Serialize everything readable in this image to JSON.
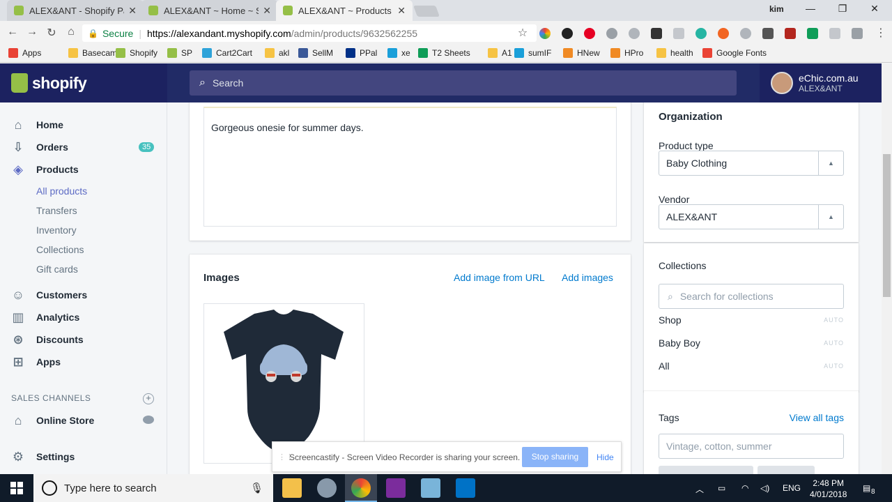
{
  "browser": {
    "tabs": [
      {
        "title": "ALEX&ANT - Shopify Par"
      },
      {
        "title": "ALEX&ANT ~ Home ~ Sh"
      },
      {
        "title": "ALEX&ANT ~ Products ~"
      }
    ],
    "profile_name": "kim",
    "secure_label": "Secure",
    "url_host": "https://alexandant.myshopify.com",
    "url_path": "/admin/products/9632562255"
  },
  "bookmarks": [
    {
      "label": "Apps",
      "color": "#e94235"
    },
    {
      "label": "Basecamp",
      "color": "#f6c344"
    },
    {
      "label": "Shopify",
      "color": "#95bf47"
    },
    {
      "label": "SP",
      "color": "#95bf47"
    },
    {
      "label": "Cart2Cart",
      "color": "#2ea3d9"
    },
    {
      "label": "akl",
      "color": "#f6c344"
    },
    {
      "label": "SellM",
      "color": "#3b5998"
    },
    {
      "label": "PPal",
      "color": "#003087"
    },
    {
      "label": "xe",
      "color": "#1a9fd9"
    },
    {
      "label": "T2 Sheets",
      "color": "#0f9d58"
    },
    {
      "label": "A1",
      "color": "#f6c344"
    },
    {
      "label": "sumIF",
      "color": "#1a9fd9"
    },
    {
      "label": "HNew",
      "color": "#f08a24"
    },
    {
      "label": "HPro",
      "color": "#f08a24"
    },
    {
      "label": "health",
      "color": "#f6c344"
    },
    {
      "label": "Google Fonts",
      "color": "#ea4335"
    }
  ],
  "header": {
    "logo": "shopify",
    "search_placeholder": "Search",
    "store_name": "eChic.com.au",
    "store_owner": "ALEX&ANT"
  },
  "sidebar": {
    "items": [
      {
        "label": "Home",
        "icon": "home-icon"
      },
      {
        "label": "Orders",
        "icon": "orders-icon",
        "badge": "35"
      },
      {
        "label": "Products",
        "icon": "tag-icon"
      }
    ],
    "sub_items": [
      "All products",
      "Transfers",
      "Inventory",
      "Collections",
      "Gift cards"
    ],
    "items2": [
      {
        "label": "Customers",
        "icon": "person-icon"
      },
      {
        "label": "Analytics",
        "icon": "bar-chart-icon"
      },
      {
        "label": "Discounts",
        "icon": "discount-icon"
      },
      {
        "label": "Apps",
        "icon": "apps-icon"
      }
    ],
    "sales_channels_label": "SALES CHANNELS",
    "online_store": "Online Store",
    "settings": "Settings"
  },
  "description": {
    "text": "Gorgeous onesie for summer days."
  },
  "images": {
    "title": "Images",
    "add_from_url": "Add image from URL",
    "add_images": "Add images"
  },
  "organization": {
    "title": "Organization",
    "product_type_label": "Product type",
    "product_type_value": "Baby Clothing",
    "vendor_label": "Vendor",
    "vendor_value": "ALEX&ANT"
  },
  "collections": {
    "title": "Collections",
    "search_placeholder": "Search for collections",
    "items": [
      {
        "name": "Shop",
        "tag": "AUTO"
      },
      {
        "name": "Baby Boy",
        "tag": "AUTO"
      },
      {
        "name": "All",
        "tag": "AUTO"
      }
    ]
  },
  "tags": {
    "title": "Tags",
    "view_all": "View all tags",
    "placeholder": "Vintage, cotton, summer"
  },
  "screencastify": {
    "message": "Screencastify - Screen Video Recorder is sharing your screen.",
    "stop": "Stop sharing",
    "hide": "Hide"
  },
  "taskbar": {
    "search_placeholder": "Type here to search",
    "lang": "ENG",
    "time": "2:48 PM",
    "date": "4/01/2018",
    "notifications": "8"
  },
  "colors": {
    "shopify_navy": "#212b66",
    "shopify_green": "#95bf47",
    "link_blue": "#007ace",
    "indigo": "#5c6ac4",
    "teal_badge": "#47c1bf"
  }
}
